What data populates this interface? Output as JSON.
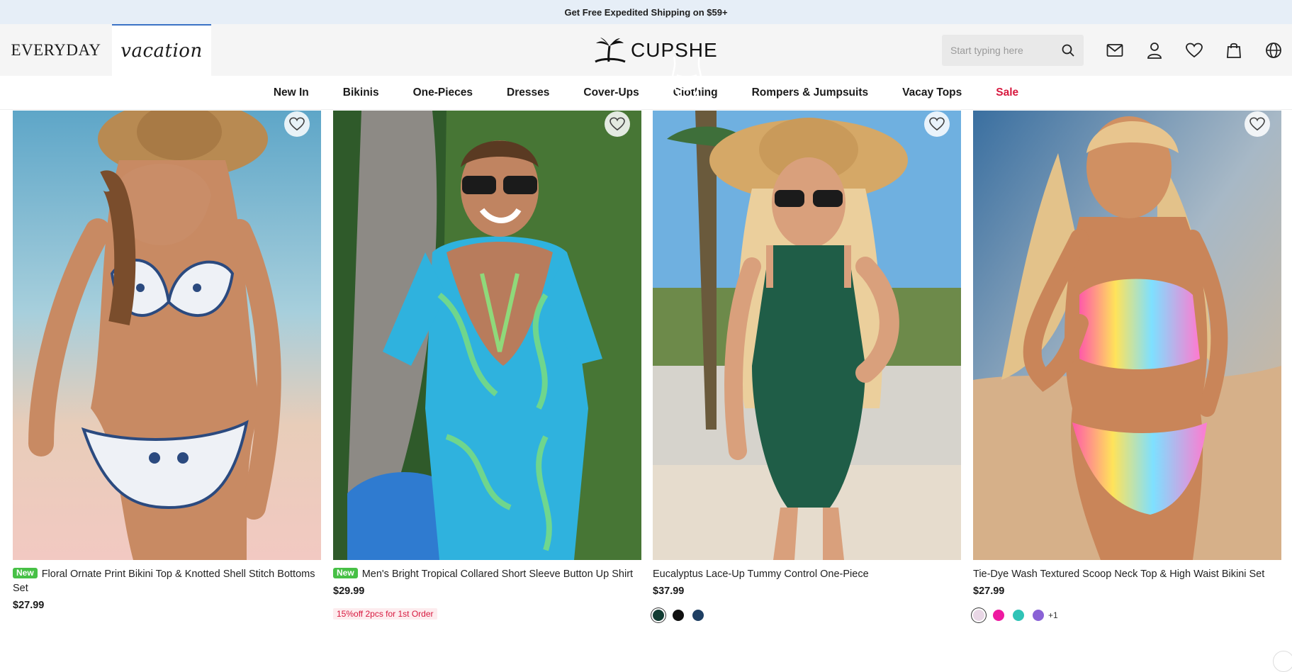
{
  "promo_bar": {
    "text": "Get Free Expedited Shipping on $59+"
  },
  "header": {
    "mode_tabs": [
      {
        "label": "EVERYDAY",
        "active": false
      },
      {
        "label": "vacation",
        "active": true
      }
    ],
    "logo_text": "CUPSHE",
    "search": {
      "placeholder": "Start typing here",
      "icon": "search-icon"
    },
    "icons": [
      "mail-icon",
      "user-icon",
      "heart-icon",
      "bag-icon",
      "globe-icon"
    ]
  },
  "nav": {
    "items": [
      {
        "label": "New In"
      },
      {
        "label": "Bikinis"
      },
      {
        "label": "One-Pieces"
      },
      {
        "label": "Dresses"
      },
      {
        "label": "Cover-Ups"
      },
      {
        "label": "Clothing"
      },
      {
        "label": "Rompers & Jumpsuits"
      },
      {
        "label": "Vacay Tops"
      },
      {
        "label": "Sale",
        "color": "#d7193f"
      }
    ]
  },
  "products": [
    {
      "badge": "New",
      "title": "Floral Ornate Print Bikini Top & Knotted Shell Stitch Bottoms Set",
      "price": "$27.99"
    },
    {
      "badge": "New",
      "title": "Men's Bright Tropical Collared Short Sleeve Button Up Shirt",
      "price": "$29.99",
      "promo": "15%off 2pcs for 1st Order"
    },
    {
      "title": "Eucalyptus Lace-Up Tummy Control One-Piece",
      "price": "$37.99",
      "swatches": [
        "#123c33",
        "#111111",
        "#1f3f63"
      ]
    },
    {
      "title": "Tie-Dye Wash Textured Scoop Neck Top & High Waist Bikini Set",
      "price": "$27.99",
      "swatches": [
        "#e9d7e6",
        "#ee1aa0",
        "#2fc3b6",
        "#8a62d6"
      ],
      "more": "+1"
    }
  ],
  "colors": {
    "accent": "#3b73c5",
    "sale": "#d7193f",
    "new_badge": "#47c046",
    "promo_bg": "#e6eef7"
  }
}
